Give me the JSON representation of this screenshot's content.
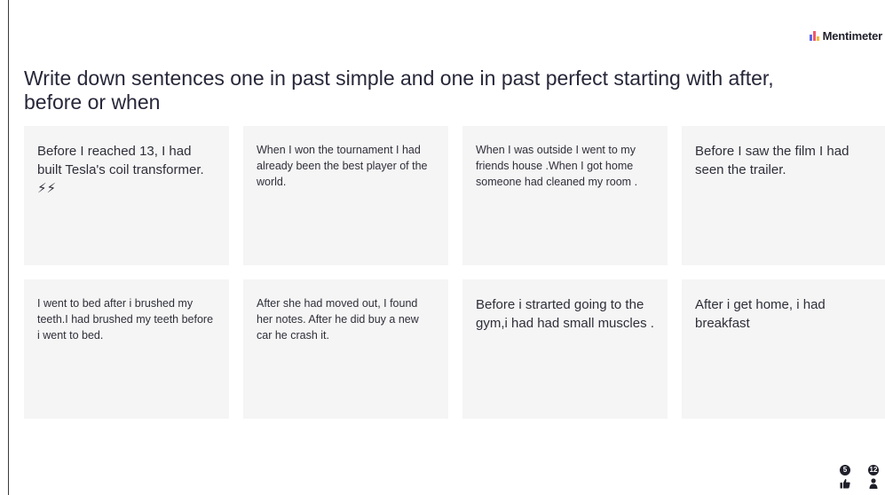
{
  "brand": {
    "name": "Mentimeter",
    "icon": "mentimeter-logo-icon"
  },
  "question": {
    "title": "Write down sentences one in past simple and one in past perfect starting with after, before or when"
  },
  "responses": [
    {
      "text": "Before I reached 13, I had built Tesla's coil transformer. ⚡⚡",
      "size": "l"
    },
    {
      "text": "When I won the tournament I had already been the best player of the world.",
      "size": "s"
    },
    {
      "text": "When I was outside I went to my friends house .When I got home someone had cleaned my room .",
      "size": "s"
    },
    {
      "text": "Before I saw the film I had seen the trailer.",
      "size": "l"
    },
    {
      "text": "I went to bed after i brushed my teeth.I had brushed my teeth before i went to bed.",
      "size": "s"
    },
    {
      "text": "After she had moved out, I found her notes. After he did buy a new car he crash it.",
      "size": "s"
    },
    {
      "text": "Before i strarted going to the gym,i had had small muscles .",
      "size": "l"
    },
    {
      "text": "After i get home, i had breakfast",
      "size": "l"
    }
  ],
  "footer": {
    "reactions_count": "5",
    "reactions_icon": "thumbs-up-icon",
    "participants_count": "12",
    "participants_icon": "person-icon"
  }
}
